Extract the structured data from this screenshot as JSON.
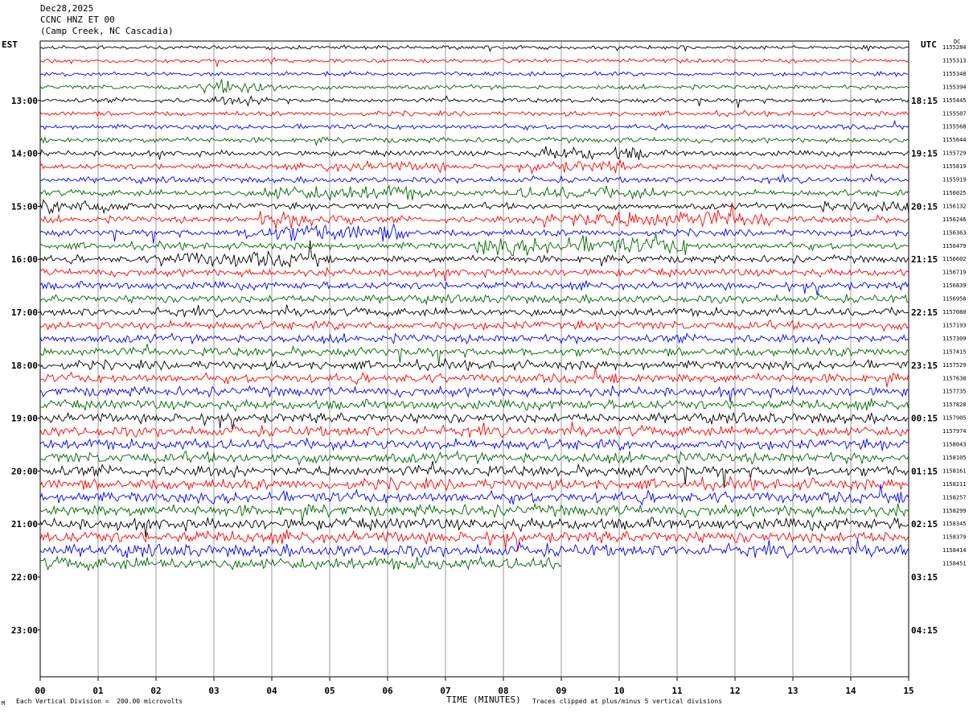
{
  "header": {
    "date": "Dec28,2025",
    "station": "CCNC HNZ ET 00",
    "location": "(Camp Creek, NC Cascadia)"
  },
  "left_tz": "EST",
  "right_tz": "UTC",
  "corner_tag": "DC",
  "footer": {
    "left": "Each Vertical Division =  200.00 microvolts",
    "center": "TIME (MINUTES)",
    "right": "Traces clipped at plus/minus 5 vertical divisions",
    "logo": "M"
  },
  "chart_data": {
    "type": "line",
    "title": "",
    "xlabel": "TIME (MINUTES)",
    "xlim": [
      0,
      15
    ],
    "x_ticks": [
      "00",
      "01",
      "02",
      "03",
      "04",
      "05",
      "06",
      "07",
      "08",
      "09",
      "10",
      "11",
      "12",
      "13",
      "14",
      "15"
    ],
    "left_hour_labels": [
      "13:00",
      "14:00",
      "15:00",
      "16:00",
      "17:00",
      "18:00",
      "19:00",
      "20:00",
      "21:00",
      "22:00",
      "23:00"
    ],
    "right_hour_labels": [
      "18:15",
      "19:15",
      "20:15",
      "21:15",
      "22:15",
      "23:15",
      "00:15",
      "01:15",
      "02:15",
      "03:15",
      "04:15"
    ],
    "trace_colors": [
      "#000000",
      "#ff0000",
      "#0000ff",
      "#006400"
    ],
    "trace_count": 40,
    "last_trace_end_minute": 9.0,
    "trace_counts": [
      1155284,
      1155313,
      1155348,
      1155394,
      1155445,
      1155507,
      1155568,
      1155644,
      1155729,
      1155819,
      1155919,
      1156025,
      1156132,
      1156246,
      1156363,
      1156479,
      1156602,
      1156719,
      1156839,
      1156958,
      1157080,
      1157193,
      1157309,
      1157415,
      1157529,
      1157638,
      1157735,
      1157828,
      1157905,
      1157974,
      1158043,
      1158105,
      1158161,
      1158211,
      1158257,
      1158299,
      1158345,
      1158379,
      1158414,
      1158451
    ],
    "grid": true
  }
}
